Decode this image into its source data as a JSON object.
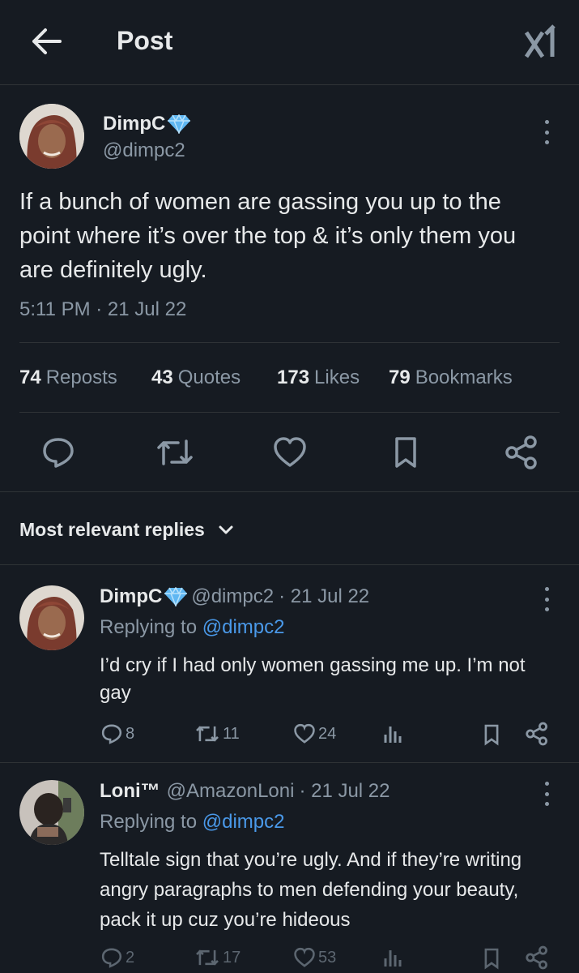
{
  "header": {
    "title": "Post",
    "back_icon": "arrow-left-icon",
    "logo": "x-logo-icon"
  },
  "post": {
    "author_name": "DimpC",
    "author_handle": "@dimpc2",
    "badge_icon": "diamond-icon",
    "text": "If a bunch of women are gassing you up to the point where it’s over the top & it’s only them you are definitely ugly.",
    "timestamp": "5:11 PM · 21 Jul 22",
    "stats": [
      {
        "count": "74",
        "label": "Reposts"
      },
      {
        "count": "43",
        "label": "Quotes"
      },
      {
        "count": "173",
        "label": "Likes"
      },
      {
        "count": "79",
        "label": "Bookmarks"
      }
    ],
    "actions": [
      "reply-icon",
      "repost-icon",
      "like-icon",
      "bookmark-icon",
      "share-icon"
    ]
  },
  "replies_filter": {
    "label": "Most relevant replies"
  },
  "replies": [
    {
      "author_name": "DimpC",
      "author_handle": "@dimpc2",
      "date": "· 21 Jul 22",
      "replying_prefix": "Replying to",
      "replying_to": "@dimpc2",
      "text": "I’d cry if I had only women gassing me up. I’m not gay",
      "replies": "8",
      "reposts": "11",
      "likes": "24"
    },
    {
      "author_name": "Loni™",
      "author_handle": "@AmazonLoni",
      "date": "· 21 Jul 22",
      "replying_prefix": "Replying to",
      "replying_to": "@dimpc2",
      "text": "Telltale sign that you’re ugly. And if they’re writing angry paragraphs to men defending your beauty, pack it up cuz you’re hideous",
      "replies": "2",
      "reposts": "17",
      "likes": "53"
    }
  ],
  "colors": {
    "background": "#161b22",
    "text": "#e7e9ea",
    "muted": "#8b98a5",
    "link": "#4a99e9",
    "divider": "#2f3336"
  }
}
